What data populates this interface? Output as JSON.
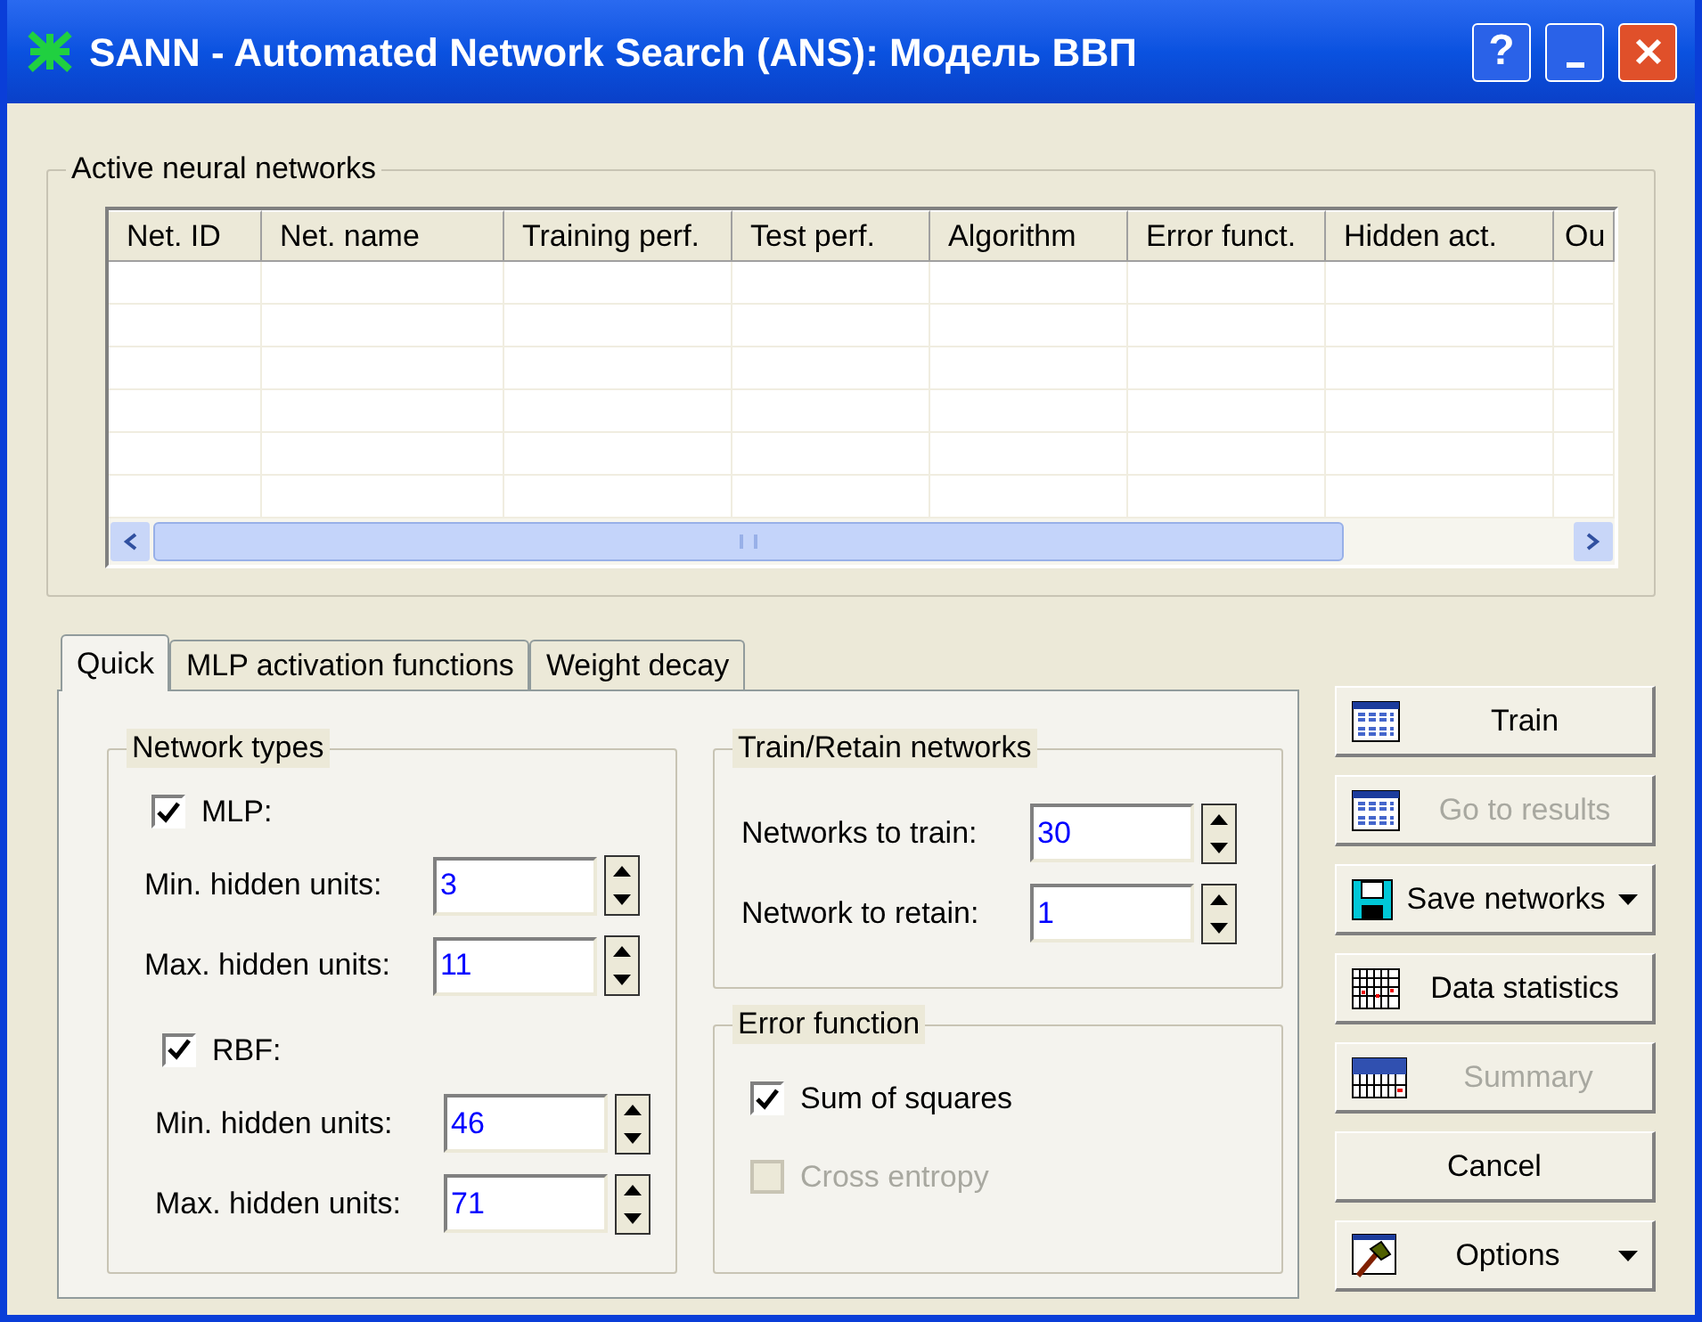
{
  "window": {
    "title": "SANN - Automated Network Search (ANS): Модель ВВП",
    "help": "?"
  },
  "networks": {
    "title": "Active neural networks",
    "columns": [
      "Net. ID",
      "Net. name",
      "Training perf.",
      "Test perf.",
      "Algorithm",
      "Error funct.",
      "Hidden act.",
      "Ou"
    ]
  },
  "tabs": [
    {
      "label": "Quick",
      "selected": true
    },
    {
      "label": "MLP activation functions",
      "selected": false
    },
    {
      "label": "Weight decay",
      "selected": false
    }
  ],
  "network_types": {
    "title": "Network types",
    "groups": [
      {
        "label": "MLP:",
        "checked": true,
        "fields": [
          {
            "label": "Min. hidden units:",
            "value": "3"
          },
          {
            "label": "Max. hidden units:",
            "value": "11"
          }
        ]
      },
      {
        "label": "RBF:",
        "checked": true,
        "fields": [
          {
            "label": "Min. hidden units:",
            "value": "46"
          },
          {
            "label": "Max. hidden units:",
            "value": "71"
          }
        ]
      }
    ]
  },
  "train_retain": {
    "title": "Train/Retain networks",
    "fields": [
      {
        "label": "Networks to train:",
        "value": "30"
      },
      {
        "label": "Network to retain:",
        "value": "1"
      }
    ]
  },
  "error_function": {
    "title": "Error function",
    "options": [
      {
        "label": "Sum of squares",
        "checked": true,
        "disabled": false
      },
      {
        "label": "Cross entropy",
        "checked": false,
        "disabled": true
      }
    ]
  },
  "buttons": [
    {
      "label": "Train",
      "kind": "table",
      "disabled": false,
      "dropdown": false
    },
    {
      "label": "Go to results",
      "kind": "table",
      "disabled": true,
      "dropdown": false
    },
    {
      "label": "Save networks",
      "kind": "floppy",
      "disabled": false,
      "dropdown": true
    },
    {
      "label": "Data statistics",
      "kind": "grid",
      "disabled": false,
      "dropdown": false
    },
    {
      "label": "Summary",
      "kind": "summary",
      "disabled": true,
      "dropdown": false
    },
    {
      "label": "Cancel",
      "kind": "plain",
      "disabled": false,
      "dropdown": false
    },
    {
      "label": "Options",
      "kind": "hammer",
      "disabled": false,
      "dropdown": true
    }
  ]
}
